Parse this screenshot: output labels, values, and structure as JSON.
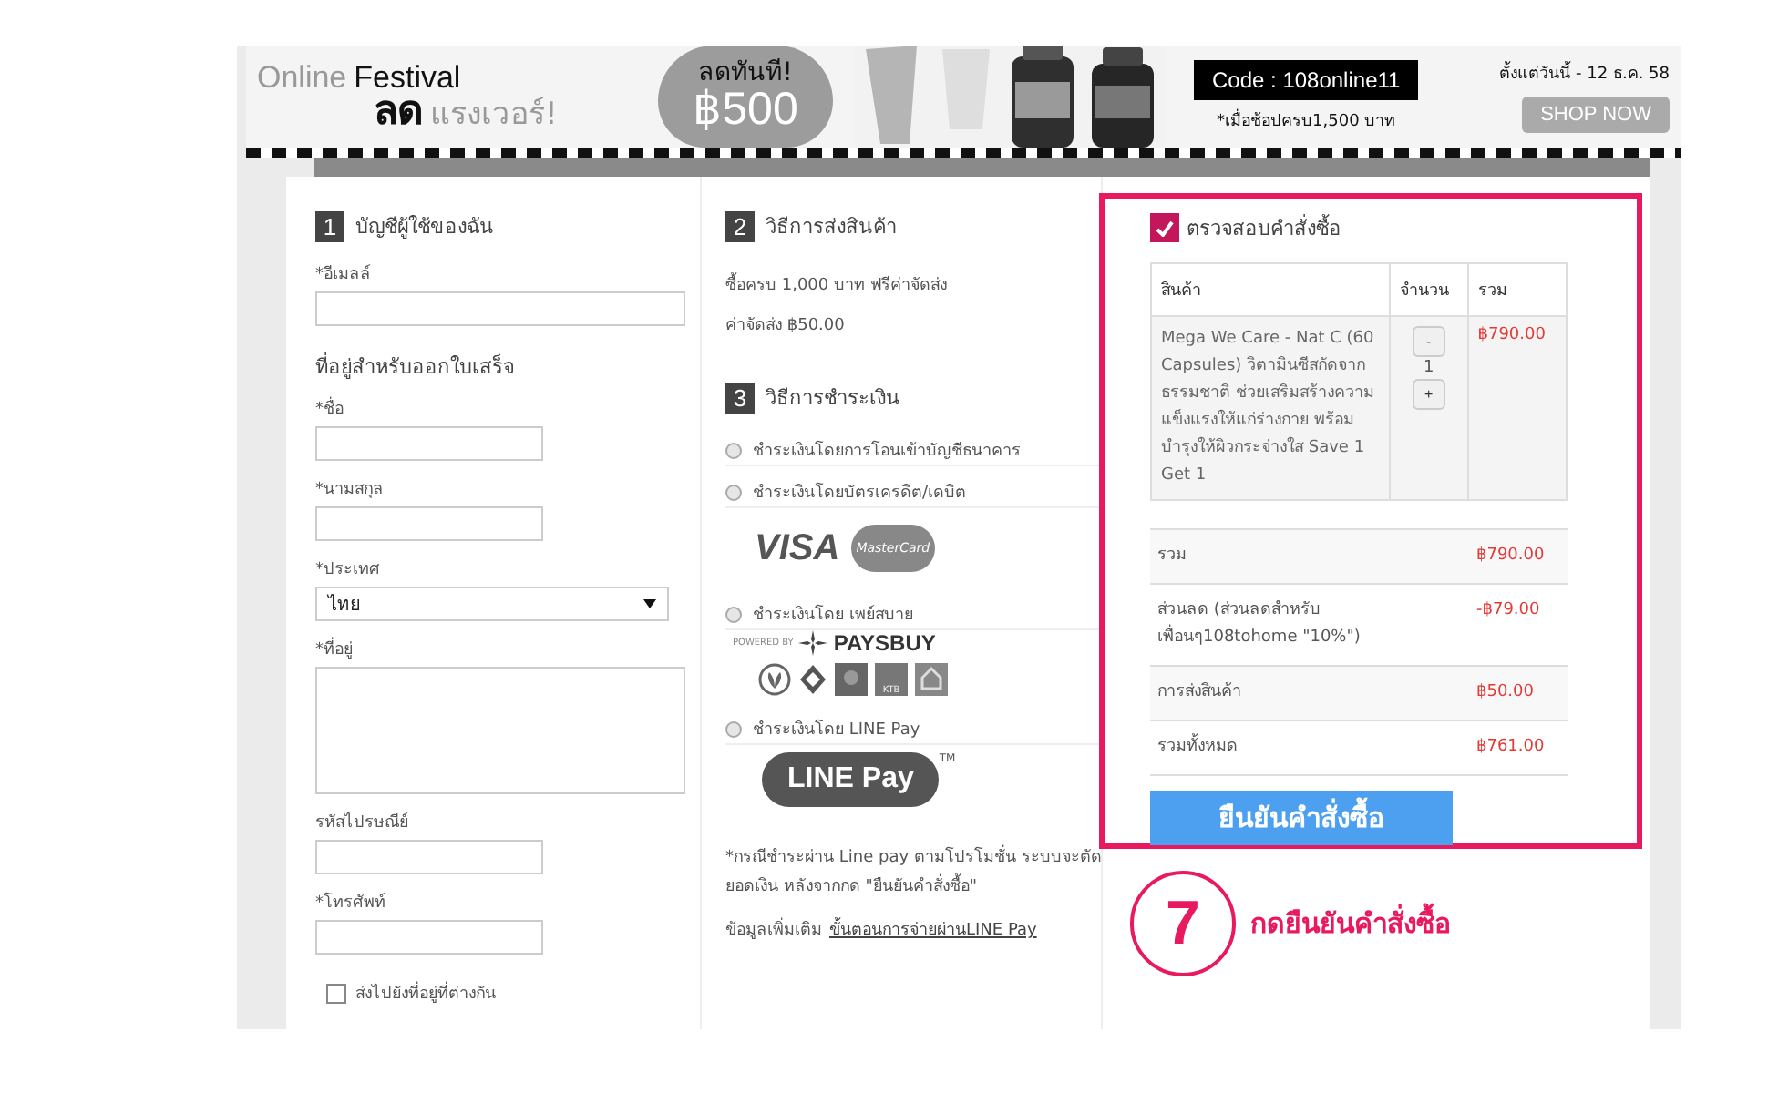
{
  "banner": {
    "online": "Online",
    "festival": "Festival",
    "sale_big": "ลด",
    "sale_rest": "แรงเวอร์!",
    "discount_title": "ลดทันที!",
    "discount_amount": "฿500",
    "code": "Code : 108online11",
    "condition": "*เมื่อช้อปครบ1,500 บาท",
    "period": "ตั้งแต่วันนี้ - 12 ธ.ค. 58",
    "shop_button": "SHOP NOW"
  },
  "account": {
    "number": "1",
    "title": "บัญชีผู้ใช้ของฉัน",
    "subheading": "ที่อยู่สำหรับออกใบเสร็จ",
    "fields": [
      {
        "kind": "email",
        "label": "*อีเมลล์"
      },
      {
        "kind": "text",
        "label": "*ชื่อ"
      },
      {
        "kind": "text",
        "label": "*นามสกุล"
      },
      {
        "kind": "select",
        "label": "*ประเทศ",
        "value": "ไทย"
      },
      {
        "kind": "textarea",
        "label": "*ที่อยู่"
      },
      {
        "kind": "text",
        "label": "รหัสไปรษณีย์"
      },
      {
        "kind": "text",
        "label": "*โทรศัพท์"
      }
    ],
    "ship_elsewhere": {
      "label": "ส่งไปยังที่อยู่ที่ต่างกัน",
      "checked": false
    }
  },
  "shipping": {
    "number": "2",
    "title": "วิธีการส่งสินค้า",
    "lines": [
      "ซื้อครบ 1,000 บาท ฟรีค่าจัดส่ง",
      "ค่าจัดส่ง ฿50.00"
    ]
  },
  "payment": {
    "number": "3",
    "title": "วิธีการชำระเงิน",
    "options": [
      {
        "kind": "bank",
        "label": "ชำระเงินโดยการโอนเข้าบัญชีธนาคาร",
        "selected": false
      },
      {
        "kind": "card",
        "label": "ชำระเงินโดยบัตรเครดิต/เดบิต",
        "selected": false,
        "logos": [
          "VISA",
          "MasterCard"
        ]
      },
      {
        "kind": "paysbuy",
        "label": "ชำระเงินโดย เพย์สบาย",
        "selected": false,
        "logos": [
          "POWERED BY",
          "PAYSBUY",
          "KTB"
        ]
      },
      {
        "kind": "linepay",
        "label": "ชำระเงินโดย LINE Pay",
        "selected": false,
        "logos": [
          "LINE Pay",
          "TM"
        ]
      }
    ],
    "note": "*กรณีชำระผ่าน Line pay ตามโปรโมชั่น ระบบจะตัดยอดเงิน หลังจากกด \"ยืนยันคำสั่งซื้อ\"",
    "more_label": "ข้อมูลเพิ่มเติม",
    "more_link": "ขั้นตอนการจ่ายผ่านLINE Pay"
  },
  "review": {
    "checked": true,
    "title": "ตรวจสอบคำสั่งซื้อ",
    "columns": [
      "สินค้า",
      "จำนวน",
      "รวม"
    ],
    "items": [
      {
        "name": "Mega We Care - Nat C (60 Capsules) วิตามินซีสกัดจากธรรมชาติ ช่วยเสริมสร้างความแข็งแรงให้แก่ร่างกาย พร้อมบำรุงให้ผิวกระจ่างใส Save 1 Get 1",
        "minus": "-",
        "quantity": "1",
        "plus": "+",
        "total": "฿790.00"
      }
    ],
    "summary": [
      {
        "label": "รวม",
        "value": "฿790.00"
      },
      {
        "label": "ส่วนลด (ส่วนลดสำหรับเพื่อนๆ108tohome \"10%\")",
        "value": "-฿79.00"
      },
      {
        "label": "การส่งสินค้า",
        "value": "฿50.00"
      },
      {
        "label": "รวมทั้งหมด",
        "value": "฿761.00"
      }
    ],
    "confirm_button": "ยืนยันคำสั่งซื้อ"
  },
  "annotation": {
    "step": "7",
    "text": "กดยืนยันคำสั่งซื้อ"
  }
}
